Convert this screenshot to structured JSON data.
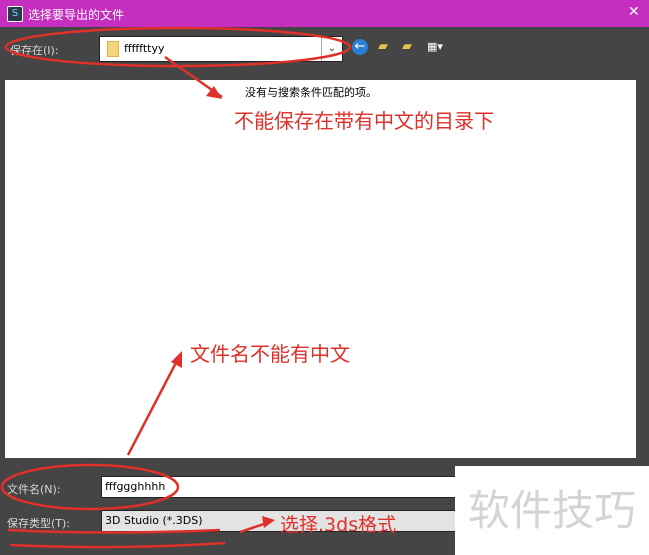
{
  "title": "选择要导出的文件",
  "save_in_label": "保存在(I):",
  "save_in_value": "fffffttyy",
  "empty_message": "没有与搜索条件匹配的项。",
  "annotations": {
    "dir": "不能保存在带有中文的目录下",
    "filename": "文件名不能有中文",
    "type": "选择.3ds格式"
  },
  "filename_label": "文件名(N):",
  "filename_value": "fffggghhhh",
  "filetype_label": "保存类型(T):",
  "filetype_value": "3D Studio (*.3DS)",
  "watermark": "软件技巧",
  "close": "✕"
}
